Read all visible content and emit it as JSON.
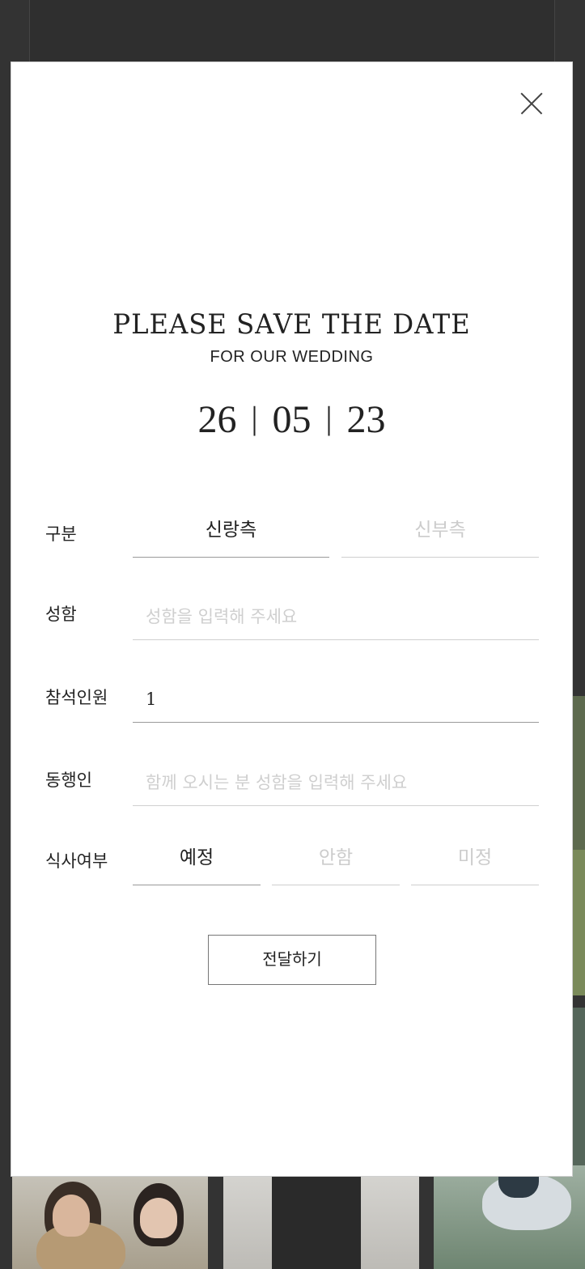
{
  "modal": {
    "title": "PLEASE SAVE THE DATE",
    "subtitle": "FOR OUR WEDDING",
    "date": {
      "day": "26",
      "month": "05",
      "year": "23"
    }
  },
  "form": {
    "side": {
      "label": "구분",
      "options": [
        "신랑측",
        "신부측"
      ],
      "selected": "신랑측"
    },
    "name": {
      "label": "성함",
      "value": "",
      "placeholder": "성함을 입력해 주세요"
    },
    "attendees": {
      "label": "참석인원",
      "value": "1"
    },
    "companion": {
      "label": "동행인",
      "value": "",
      "placeholder": "함께 오시는 분 성함을 입력해 주세요"
    },
    "meal": {
      "label": "식사여부",
      "options": [
        "예정",
        "안함",
        "미정"
      ],
      "selected": "예정"
    },
    "submit_label": "전달하기"
  },
  "colors": {
    "overlay": "#333333",
    "text": "#222222",
    "placeholder": "#cfcfcf",
    "line": "#cfcfcf"
  }
}
